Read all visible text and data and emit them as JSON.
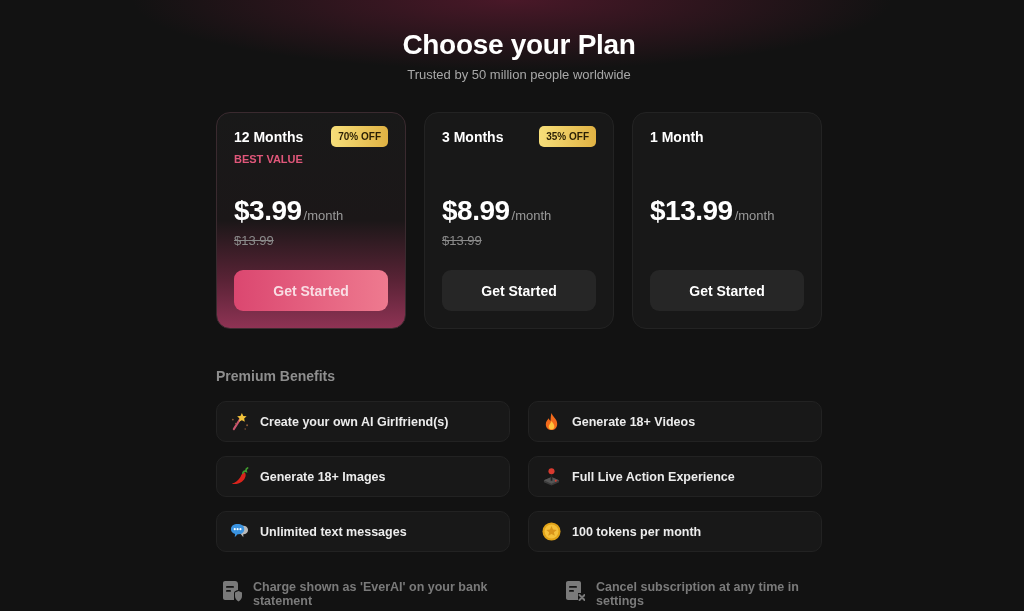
{
  "header": {
    "title": "Choose your Plan",
    "subtitle": "Trusted by 50 million people worldwide"
  },
  "plans": [
    {
      "name": "12 Months",
      "badge": "70% OFF",
      "tag": "BEST VALUE",
      "price": "$3.99",
      "period": "/month",
      "original_price": "$13.99",
      "button": "Get Started",
      "selected": true
    },
    {
      "name": "3 Months",
      "badge": "35% OFF",
      "price": "$8.99",
      "period": "/month",
      "original_price": "$13.99",
      "button": "Get Started",
      "selected": false
    },
    {
      "name": "1 Month",
      "price": "$13.99",
      "period": "/month",
      "button": "Get Started",
      "selected": false
    }
  ],
  "benefits": {
    "title": "Premium Benefits",
    "items": [
      "Create your own AI Girlfriend(s)",
      "Generate 18+ Videos",
      "Generate 18+ Images",
      "Full Live Action Experience",
      "Unlimited text messages",
      "100 tokens per month"
    ]
  },
  "notes": [
    "Charge shown as 'EverAI' on your bank statement",
    "Cancel subscription at any time in settings"
  ]
}
